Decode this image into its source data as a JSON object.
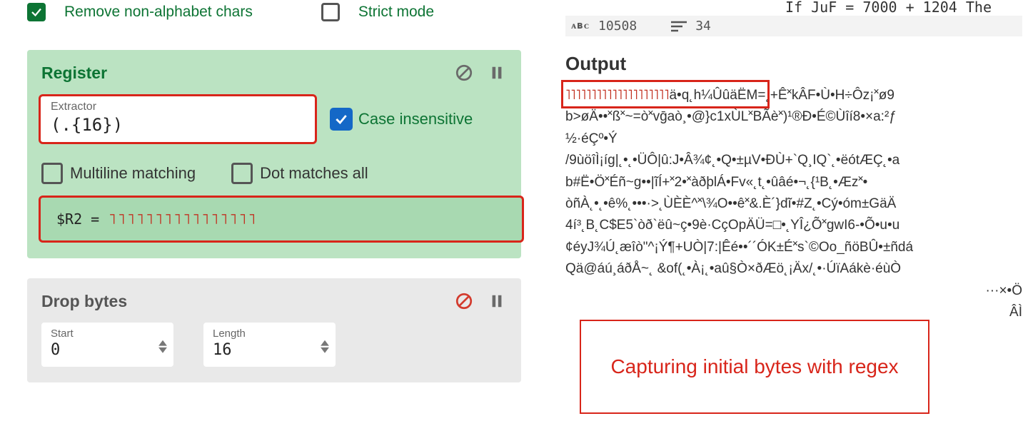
{
  "topOptions": {
    "opt1": "Remove non-alphabet chars",
    "opt2": "Strict mode"
  },
  "register": {
    "title": "Register",
    "extractorLabel": "Extractor",
    "extractorValue": "(.{16})",
    "caseInsensitive": "Case insensitive",
    "multiline": "Multiline matching",
    "dotAll": "Dot matches all",
    "resultLabel": "$R2 = ",
    "resultValue": "˥˥˥˥˥˥˥˥˥˥˥˥˥˥˥˥"
  },
  "drop": {
    "title": "Drop bytes",
    "startLabel": "Start",
    "startValue": "0",
    "lengthLabel": "Length",
    "lengthValue": "16"
  },
  "code": {
    "fragment": "If JuF = 7000 + 1204 The"
  },
  "stats": {
    "abc": "ᴀʙᴄ",
    "chars": "10508",
    "lines": "34"
  },
  "output": {
    "title": "Output",
    "line1pre": "˥˥˥˥˥˥˥˥˥˥˥˥˥˥˥˥˥˥˥˥",
    "line1post": "ä•q˛h¼ÛûäËM=˛+Ê˟kÂF•Ù•H÷Ôz¡˟ø9",
    "line2": "b>øÄ••˟ß˟~=ò˟vḡaò¸•@}c1xÙL˟BÃè˟)¹®Ð•É©Ùîí8•×a:²ƒ",
    "line3": "½·éÇº•Ý",
    "line4": "/9ùöîÌ¡íg|˛•˛•ÜÔ|û:J•Â¾¢˛•Q•±µV•ÐÙ+`Q¸IQ`˛•ëótÆÇ˛•a",
    "line5": "b#Ë•Ö˟Éñ~g••|ĩÍ+˟2•˟àðþlÁ•Fv«˛t˛•ûâé•¬˛{¹B˛•Æz˟•",
    "line6": "òñÀ˛•˛•ê%˛•••·>˛ÙÈÈ^˟\\¾O••ê˟&.È´}dĩ•#Z˛•Cý•óm±GäÄ",
    "line7": "4í³˛B˛C$E5`òð`ëû~ç•9è·CçOpÄÜ=□•˛YÎ¿Õ˟gwI6-•Õ•u•u",
    "line8": "¢éyJ¾Ú˛æîò\"^¡Ý¶+UÒ|7:|Êé••´´ÓK±É˟s`©Oo_ñöBÛ•±ñdá",
    "line9": "Qä@áú¸áðÅ~˛ &of(˛•À¡˛•aû§Ò×ðÆö˛¡Äx/˛•·ÚïAákè·éùÒ",
    "line10": "···×•Ö",
    "line11": "ÂÌ"
  },
  "annotation": "Capturing initial bytes with regex"
}
